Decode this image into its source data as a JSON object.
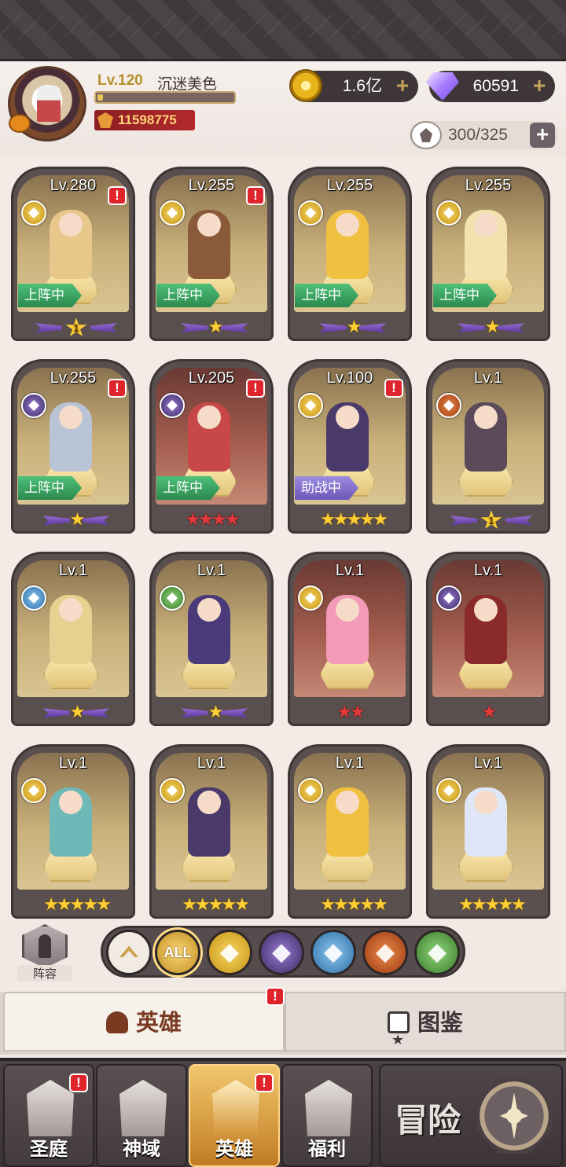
{
  "player": {
    "level": "Lv.120",
    "name": "沉迷美色",
    "exp_progress": 0.04,
    "power": "11598775"
  },
  "currency": {
    "gold": "1.6亿",
    "gems": "60591"
  },
  "capacity": "300/325",
  "heroes": [
    {
      "level": "Lv.280",
      "faction": "gold",
      "alert": "!",
      "tag": "上阵中",
      "tag_type": "active",
      "stars": "1",
      "star_style": "badge",
      "bg": "gold",
      "color": "#e8c88a"
    },
    {
      "level": "Lv.255",
      "faction": "gold",
      "alert": "!",
      "tag": "上阵中",
      "tag_type": "active",
      "stars": "★",
      "star_style": "wing",
      "bg": "gold",
      "color": "#8a5a3a"
    },
    {
      "level": "Lv.255",
      "faction": "gold",
      "alert": "",
      "tag": "上阵中",
      "tag_type": "active",
      "stars": "★",
      "star_style": "wing",
      "bg": "gold",
      "color": "#f0c040"
    },
    {
      "level": "Lv.255",
      "faction": "gold",
      "alert": "",
      "tag": "上阵中",
      "tag_type": "active",
      "stars": "★",
      "star_style": "wing",
      "bg": "gold",
      "color": "#f3e2b0"
    },
    {
      "level": "Lv.255",
      "faction": "dark",
      "alert": "!",
      "tag": "上阵中",
      "tag_type": "active",
      "stars": "★",
      "star_style": "wing",
      "bg": "gold",
      "color": "#b9c3d6"
    },
    {
      "level": "Lv.205",
      "faction": "dark",
      "alert": "!",
      "tag": "上阵中",
      "tag_type": "active",
      "stars": "★★★★",
      "star_style": "red",
      "bg": "red",
      "color": "#c8484a"
    },
    {
      "level": "Lv.100",
      "faction": "gold",
      "alert": "!",
      "tag": "助战中",
      "tag_type": "assist",
      "stars": "★★★★★",
      "star_style": "gold",
      "bg": "gold",
      "color": "#4a3a6a"
    },
    {
      "level": "Lv.1",
      "faction": "fox",
      "alert": "",
      "tag": "",
      "tag_type": "",
      "stars": "1",
      "star_style": "badge",
      "bg": "gold",
      "color": "#5a4a5a"
    },
    {
      "level": "Lv.1",
      "faction": "holy",
      "alert": "",
      "tag": "",
      "tag_type": "",
      "stars": "★",
      "star_style": "wing",
      "bg": "gold",
      "color": "#e8d090"
    },
    {
      "level": "Lv.1",
      "faction": "tree",
      "alert": "",
      "tag": "",
      "tag_type": "",
      "stars": "★",
      "star_style": "wing",
      "bg": "gold",
      "color": "#4a3a7a"
    },
    {
      "level": "Lv.1",
      "faction": "gold",
      "alert": "",
      "tag": "",
      "tag_type": "",
      "stars": "★★",
      "star_style": "red",
      "bg": "red",
      "color": "#f29ab8"
    },
    {
      "level": "Lv.1",
      "faction": "dark",
      "alert": "",
      "tag": "",
      "tag_type": "",
      "stars": "★",
      "star_style": "red",
      "bg": "red",
      "color": "#8a2a2a"
    },
    {
      "level": "Lv.1",
      "faction": "gold",
      "alert": "",
      "tag": "",
      "tag_type": "",
      "stars": "★★★★★",
      "star_style": "gold",
      "bg": "gold",
      "color": "#6fb8b8"
    },
    {
      "level": "Lv.1",
      "faction": "gold",
      "alert": "",
      "tag": "",
      "tag_type": "",
      "stars": "★★★★★",
      "star_style": "gold",
      "bg": "gold",
      "color": "#4a3a6a"
    },
    {
      "level": "Lv.1",
      "faction": "gold",
      "alert": "",
      "tag": "",
      "tag_type": "",
      "stars": "★★★★★",
      "star_style": "gold",
      "bg": "gold",
      "color": "#f0c040"
    },
    {
      "level": "Lv.1",
      "faction": "gold",
      "alert": "",
      "tag": "",
      "tag_type": "",
      "stars": "★★★★★",
      "star_style": "gold",
      "bg": "gold",
      "color": "#dfe6f7"
    }
  ],
  "roster_label": "阵容",
  "filters": {
    "all_label": "ALL",
    "items": [
      "sort-up-icon",
      "all",
      "gold-faction-icon",
      "dark-faction-icon",
      "holy-faction-icon",
      "fox-faction-icon",
      "tree-faction-icon"
    ]
  },
  "subtabs": {
    "heroes": "英雄",
    "codex": "图鉴",
    "alert": "!"
  },
  "nav": [
    {
      "label": "圣庭",
      "alert": "!",
      "active": false
    },
    {
      "label": "神域",
      "alert": "",
      "active": false
    },
    {
      "label": "英雄",
      "alert": "!",
      "active": true
    },
    {
      "label": "福利",
      "alert": "",
      "active": false
    }
  ],
  "adventure_label": "冒险",
  "plus_symbol": "+"
}
